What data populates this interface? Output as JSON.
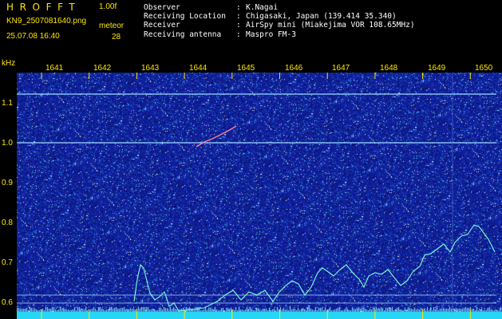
{
  "header": {
    "app_title": "HROFFT",
    "version": "1.00f",
    "filename": "KN9_2507081640.png",
    "datetime": "25.07.08 16:40",
    "mode": "meteor",
    "count": "28"
  },
  "info": [
    {
      "label": "Observer",
      "value": "K.Nagai"
    },
    {
      "label": "Receiving Location",
      "value": "Chigasaki, Japan (139.414 35.340)"
    },
    {
      "label": "Receiver",
      "value": "AirSpy mini (Miakejima VOR 108.65MHz)"
    },
    {
      "label": "Receiving antenna",
      "value": "Maspro FM-3"
    }
  ],
  "axis": {
    "unit": "kHz",
    "y_ticks": [
      "1.1",
      "1.0",
      "0.9",
      "0.8",
      "0.7",
      "0.6"
    ],
    "y_values": [
      1.1,
      1.0,
      0.9,
      0.8,
      0.7,
      0.6
    ],
    "x_ticks": [
      "1641",
      "1642",
      "1643",
      "1644",
      "1645",
      "1646",
      "1647",
      "1648",
      "1649",
      "1650"
    ]
  },
  "colors": {
    "background": "#000000",
    "label_yellow": "#ffe600",
    "noise_base": "#14238c",
    "trace": "#7fffd4",
    "hline": "#9fdcff",
    "power_strip": "#26d7f5"
  }
}
